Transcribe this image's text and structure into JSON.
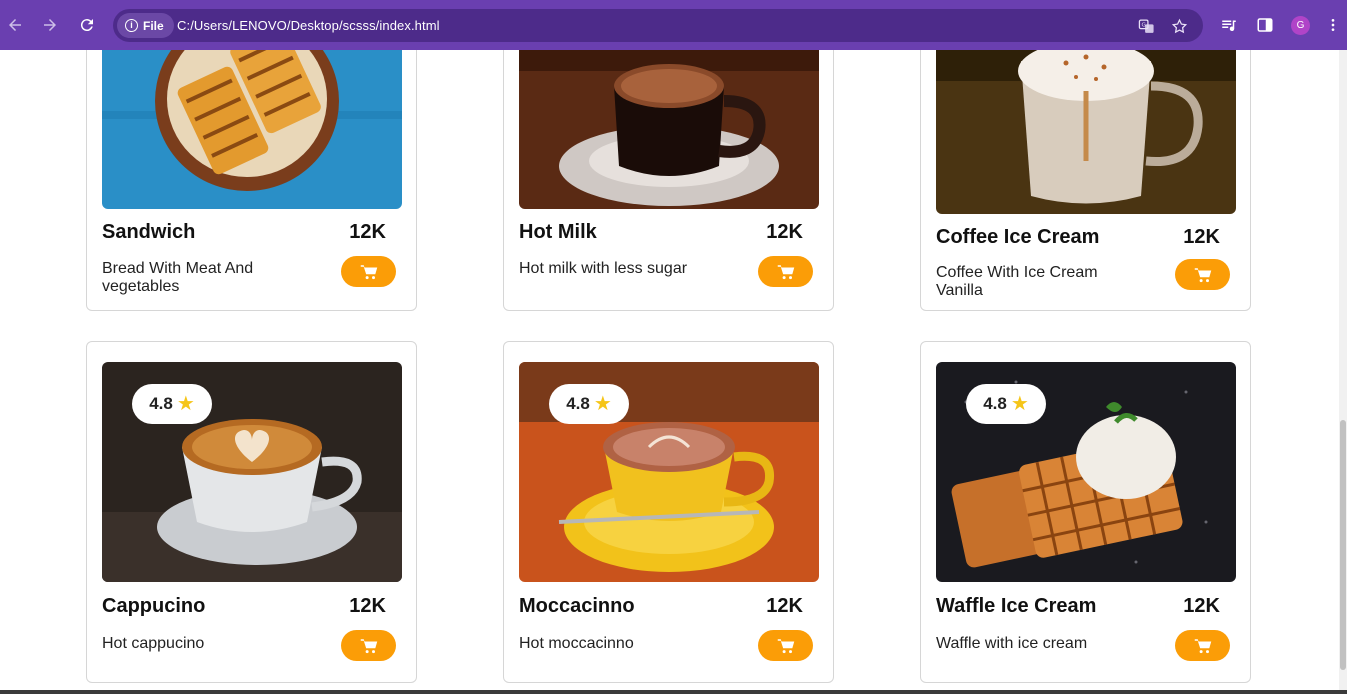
{
  "browser": {
    "site_chip_label": "File",
    "url": "C:/Users/LENOVO/Desktop/scsss/index.html",
    "profile_initial": "G",
    "theme_color": "#6a3fb0"
  },
  "menu": {
    "accent_color": "#fb9d07",
    "star_color": "#f5c518",
    "items": [
      {
        "name": "Sandwich",
        "price": "12K",
        "description": "Bread With Meat And vegetables",
        "rating": "",
        "icon": "sandwich-image"
      },
      {
        "name": "Hot Milk",
        "price": "12K",
        "description": "Hot milk with less sugar",
        "rating": "",
        "icon": "hot-milk-image"
      },
      {
        "name": "Coffee Ice Cream",
        "price": "12K",
        "description": "Coffee With Ice Cream Vanilla",
        "rating": "",
        "icon": "coffee-ice-cream-image"
      },
      {
        "name": "Cappucino",
        "price": "12K",
        "description": "Hot cappucino",
        "rating": "4.8",
        "icon": "cappucino-image"
      },
      {
        "name": "Moccacinno",
        "price": "12K",
        "description": "Hot moccacinno",
        "rating": "4.8",
        "icon": "moccacinno-image"
      },
      {
        "name": "Waffle Ice Cream",
        "price": "12K",
        "description": "Waffle with ice cream",
        "rating": "4.8",
        "icon": "waffle-ice-cream-image"
      }
    ]
  }
}
